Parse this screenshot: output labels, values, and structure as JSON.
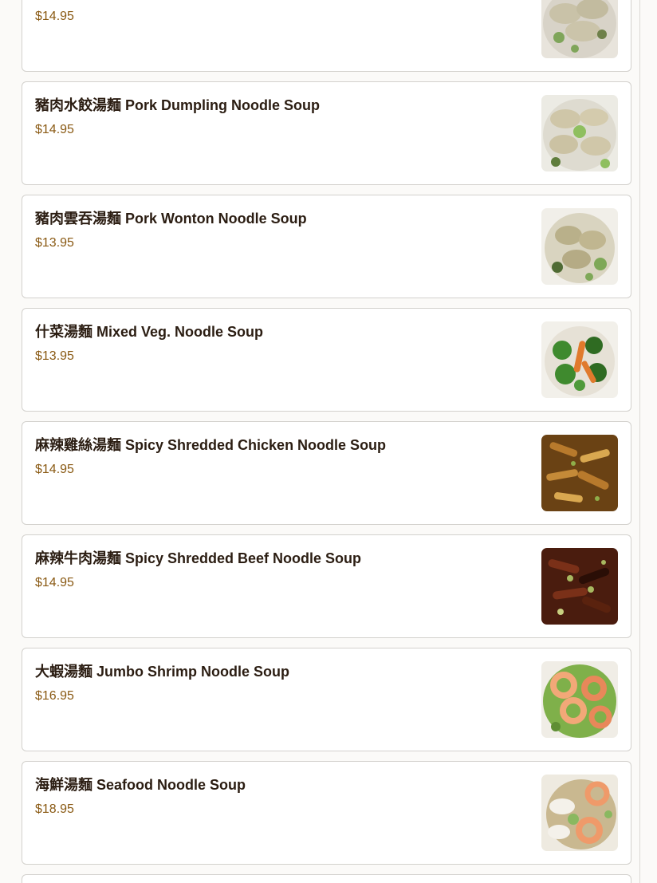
{
  "menu": {
    "items": [
      {
        "name": "",
        "price": "$14.95",
        "image": "dumpling-soup-photo",
        "colors": {
          "bowl": "#e8e4dc",
          "food": "#c9c2a8",
          "accent": "#7fa55a",
          "dark": "#6e8049"
        }
      },
      {
        "name": "豬肉水餃湯麵 Pork Dumpling Noodle Soup",
        "price": "$14.95",
        "image": "pork-dumpling-soup-photo",
        "colors": {
          "bowl": "#ecebe4",
          "food": "#cfc6a8",
          "accent": "#8fbf5f",
          "dark": "#5f7d3c"
        }
      },
      {
        "name": "豬肉雲吞湯麵 Pork Wonton Noodle Soup",
        "price": "$13.95",
        "image": "pork-wonton-soup-photo",
        "colors": {
          "bowl": "#f1efe9",
          "food": "#b9b08a",
          "accent": "#7ea857",
          "dark": "#4f6b34"
        }
      },
      {
        "name": "什菜湯麵 Mixed Veg. Noodle Soup",
        "price": "$13.95",
        "image": "mixed-veg-soup-photo",
        "colors": {
          "bowl": "#f2f0ea",
          "food": "#3f8a2e",
          "accent": "#e07a2c",
          "dark": "#2f6b22"
        }
      },
      {
        "name": "麻辣雞絲湯麵 Spicy Shredded Chicken Noodle Soup",
        "price": "$14.95",
        "image": "spicy-chicken-soup-photo",
        "colors": {
          "bowl": "#6a4214",
          "food": "#b87a2c",
          "accent": "#d9a850",
          "dark": "#4a2a0c"
        }
      },
      {
        "name": "麻辣牛肉湯麵 Spicy Shredded Beef Noodle Soup",
        "price": "$14.95",
        "image": "spicy-beef-soup-photo",
        "colors": {
          "bowl": "#4a1c0e",
          "food": "#7a3018",
          "accent": "#a8b860",
          "dark": "#2a0e06"
        }
      },
      {
        "name": "大蝦湯麵 Jumbo Shrimp Noodle Soup",
        "price": "$16.95",
        "image": "jumbo-shrimp-soup-photo",
        "colors": {
          "bowl": "#f0ede6",
          "food": "#f2a878",
          "accent": "#7fb04a",
          "dark": "#e8885a"
        }
      },
      {
        "name": "海鮮湯麵 Seafood Noodle Soup",
        "price": "$18.95",
        "image": "seafood-soup-photo",
        "colors": {
          "bowl": "#eeeae0",
          "food": "#ef9a6a",
          "accent": "#8ab860",
          "dark": "#c9b890"
        }
      }
    ]
  }
}
